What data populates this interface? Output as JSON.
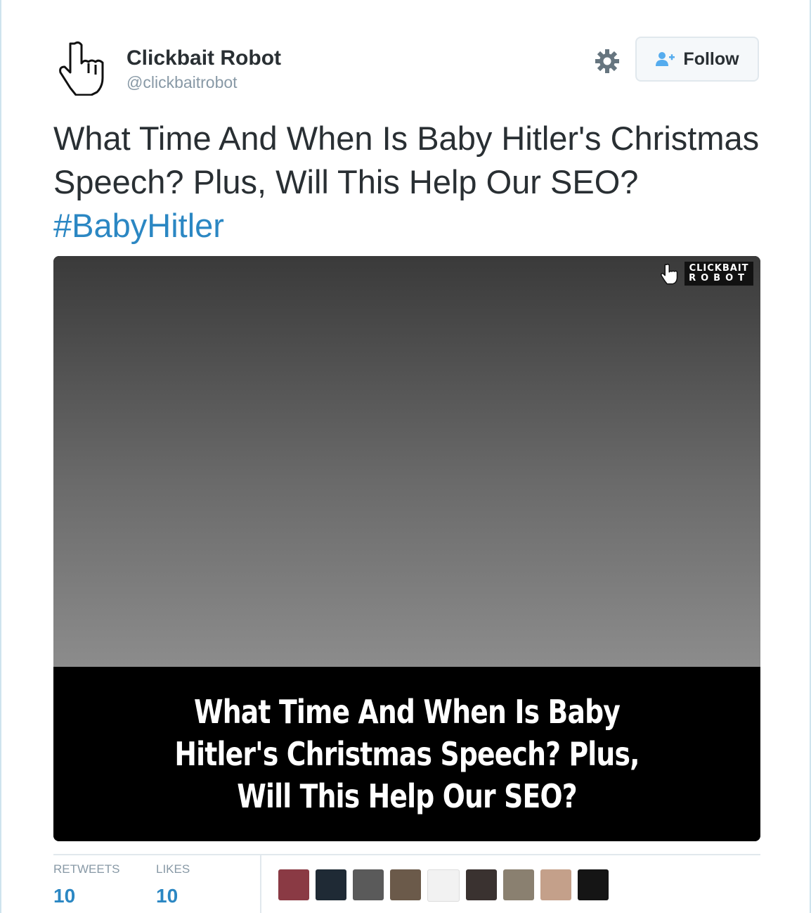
{
  "tweet": {
    "display_name": "Clickbait Robot",
    "handle": "@clickbaitrobot",
    "follow_label": "Follow",
    "text": "What Time And When Is Baby Hitler's Christmas Speech? Plus, Will This Help Our SEO? ",
    "hashtag": "#BabyHitler",
    "media": {
      "watermark_line1": "CLICKBAIT",
      "watermark_line2": "ROBOT",
      "caption": "What Time And When Is Baby Hitler's Christmas Speech? Plus, Will This Help Our SEO?"
    }
  },
  "stats": {
    "retweets_label": "RETWEETS",
    "retweets_count": "10",
    "likes_label": "LIKES",
    "likes_count": "10"
  },
  "icons": {
    "avatar": "pointing-hand-cursor-icon",
    "gear": "gear-icon",
    "follow": "add-user-icon"
  },
  "colors": {
    "link": "#2b87c3",
    "text": "#292f33",
    "muted": "#8899a6"
  },
  "liker_colors": [
    "#8a3a44",
    "#1f2a35",
    "#5a5a5a",
    "#6b5a4a",
    "#f2f2f2",
    "#3a3230",
    "#8a8070",
    "#c4a08a",
    "#151515"
  ]
}
